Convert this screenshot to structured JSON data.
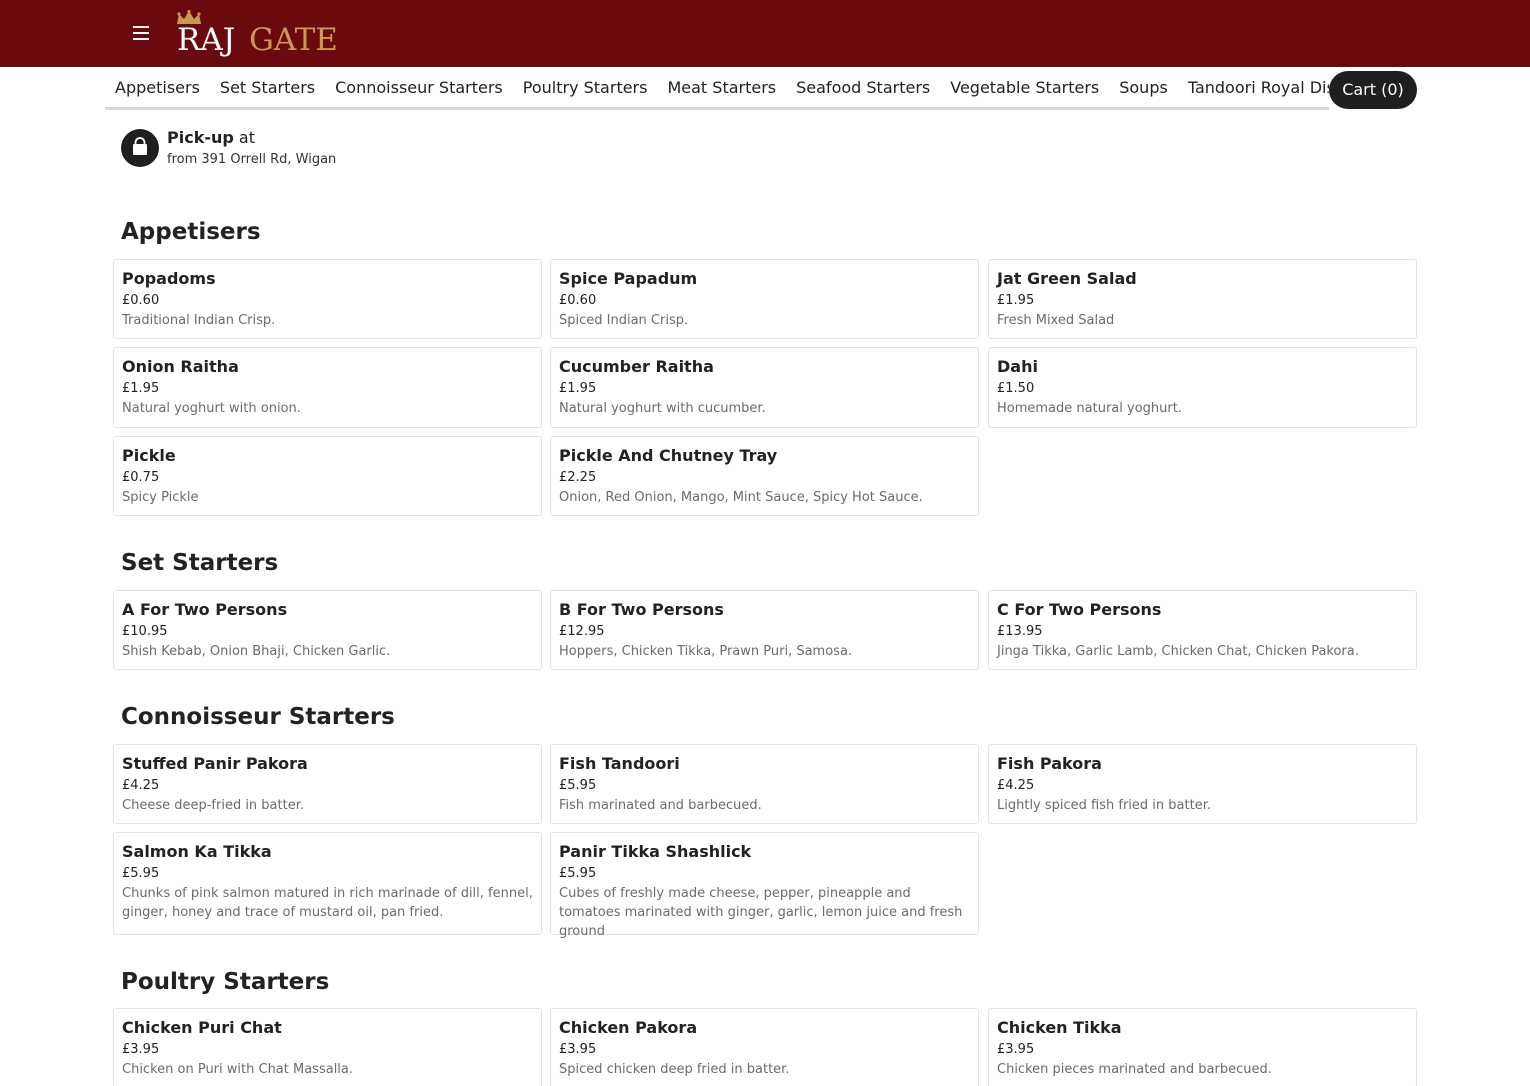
{
  "brand": {
    "logo_part1": "RAJ",
    "logo_part2": "GATE",
    "crown_icon": "crown-icon",
    "crown_color": "#c89a52"
  },
  "colors": {
    "header_bg": "#6b0a0e",
    "accent_gold": "#c89a52",
    "dark": "#1f1f1f"
  },
  "header": {
    "menu_icon": "hamburger-menu-icon"
  },
  "categories": [
    "Appetisers",
    "Set Starters",
    "Connoisseur Starters",
    "Poultry Starters",
    "Meat Starters",
    "Seafood Starters",
    "Vegetable Starters",
    "Soups",
    "Tandoori Royal Dishes"
  ],
  "active_category": "Appetisers",
  "cart": {
    "label": "Cart (0)"
  },
  "pickup": {
    "icon": "shopping-bag-icon",
    "title_bold": "Pick-up",
    "title_rest": "at",
    "address": "from 391 Orrell Rd, Wigan"
  },
  "sections": [
    {
      "title": "Appetisers",
      "items": [
        {
          "name": "Popadoms",
          "price": "£0.60",
          "desc": "Traditional Indian Crisp."
        },
        {
          "name": "Spice Papadum",
          "price": "£0.60",
          "desc": "Spiced Indian Crisp."
        },
        {
          "name": "Jat Green Salad",
          "price": "£1.95",
          "desc": "Fresh Mixed Salad"
        },
        {
          "name": "Onion Raitha",
          "price": "£1.95",
          "desc": "Natural yoghurt with onion."
        },
        {
          "name": "Cucumber Raitha",
          "price": "£1.95",
          "desc": "Natural yoghurt with cucumber."
        },
        {
          "name": "Dahi",
          "price": "£1.50",
          "desc": "Homemade natural yoghurt."
        },
        {
          "name": "Pickle",
          "price": "£0.75",
          "desc": "Spicy Pickle"
        },
        {
          "name": "Pickle And Chutney Tray",
          "price": "£2.25",
          "desc": "Onion, Red Onion, Mango, Mint Sauce, Spicy Hot Sauce."
        }
      ]
    },
    {
      "title": "Set Starters",
      "items": [
        {
          "name": "A For Two Persons",
          "price": "£10.95",
          "desc": "Shish Kebab, Onion Bhaji, Chicken Garlic."
        },
        {
          "name": "B For Two Persons",
          "price": "£12.95",
          "desc": "Hoppers, Chicken Tikka, Prawn Puri, Samosa."
        },
        {
          "name": "C For Two Persons",
          "price": "£13.95",
          "desc": "Jinga Tikka, Garlic Lamb, Chicken Chat, Chicken Pakora."
        }
      ]
    },
    {
      "title": "Connoisseur Starters",
      "items": [
        {
          "name": "Stuffed Panir Pakora",
          "price": "£4.25",
          "desc": "Cheese deep-fried in batter."
        },
        {
          "name": "Fish Tandoori",
          "price": "£5.95",
          "desc": "Fish marinated and barbecued."
        },
        {
          "name": "Fish Pakora",
          "price": "£4.25",
          "desc": "Lightly spiced fish fried in batter."
        },
        {
          "name": "Salmon Ka Tikka",
          "price": "£5.95",
          "desc": "Chunks of pink salmon matured in rich marinade of dill, fennel, ginger, honey and trace of mustard oil, pan fried."
        },
        {
          "name": "Panir Tikka Shashlick",
          "price": "£5.95",
          "desc": "Cubes of freshly made cheese, pepper, pineapple and tomatoes marinated with ginger, garlic, lemon juice and fresh ground"
        }
      ]
    },
    {
      "title": "Poultry Starters",
      "items": [
        {
          "name": "Chicken Puri Chat",
          "price": "£3.95",
          "desc": "Chicken on Puri with Chat Massalla."
        },
        {
          "name": "Chicken Pakora",
          "price": "£3.95",
          "desc": "Spiced chicken deep fried in batter."
        },
        {
          "name": "Chicken Tikka",
          "price": "£3.95",
          "desc": "Chicken pieces marinated and barbecued."
        }
      ]
    }
  ]
}
